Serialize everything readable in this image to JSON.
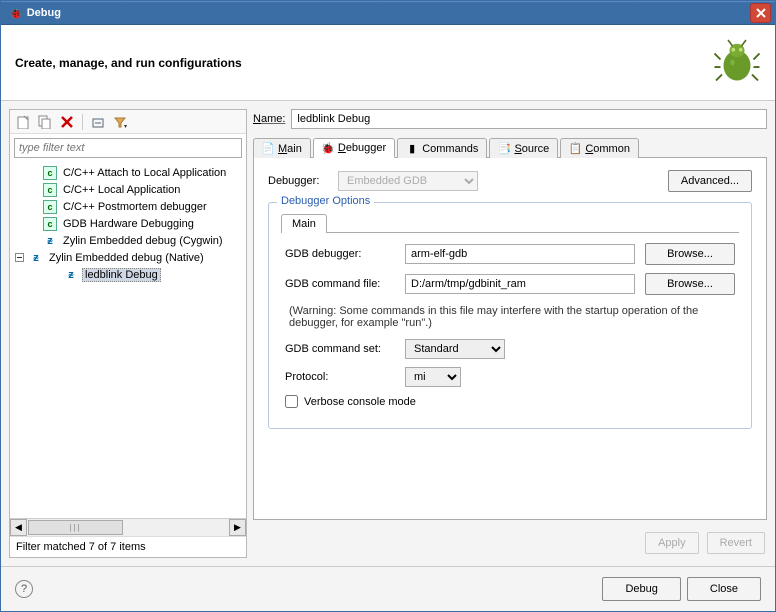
{
  "window": {
    "title": "Debug"
  },
  "header": {
    "text": "Create, manage, and run configurations"
  },
  "sidebar": {
    "filter_placeholder": "type filter text",
    "items": [
      {
        "label": "C/C++ Attach to Local Application",
        "icon": "c"
      },
      {
        "label": "C/C++ Local Application",
        "icon": "c"
      },
      {
        "label": "C/C++ Postmortem debugger",
        "icon": "c"
      },
      {
        "label": "GDB Hardware Debugging",
        "icon": "c"
      },
      {
        "label": "Zylin Embedded debug (Cygwin)",
        "icon": "z"
      },
      {
        "label": "Zylin Embedded debug (Native)",
        "icon": "z",
        "expanded": true
      },
      {
        "label": "ledblink Debug",
        "icon": "z",
        "child": true,
        "selected": true
      }
    ],
    "filter_status": "Filter matched 7 of 7 items"
  },
  "main": {
    "name_label": "Name:",
    "name_value": "ledblink Debug",
    "tabs": [
      {
        "label": "Main",
        "u": "M"
      },
      {
        "label": "Debugger",
        "u": "D",
        "active": true
      },
      {
        "label": "Commands",
        "u": ""
      },
      {
        "label": "Source",
        "u": "S"
      },
      {
        "label": "Common",
        "u": "C"
      }
    ],
    "debugger_label": "Debugger:",
    "debugger_value": "Embedded GDB",
    "advanced_btn": "Advanced...",
    "options_legend": "Debugger Options",
    "sub_tab": "Main",
    "gdb_debugger_label": "GDB debugger:",
    "gdb_debugger_value": "arm-elf-gdb",
    "gdb_cmdfile_label": "GDB command file:",
    "gdb_cmdfile_value": "D:/arm/tmp/gdbinit_ram",
    "browse": "Browse...",
    "warning": "(Warning: Some commands in this file may interfere with the startup operation of the debugger, for example \"run\".)",
    "cmdset_label": "GDB command set:",
    "cmdset_value": "Standard",
    "protocol_label": "Protocol:",
    "protocol_value": "mi",
    "verbose_label": "Verbose console mode",
    "apply": "Apply",
    "revert": "Revert"
  },
  "footer": {
    "debug": "Debug",
    "close": "Close"
  }
}
